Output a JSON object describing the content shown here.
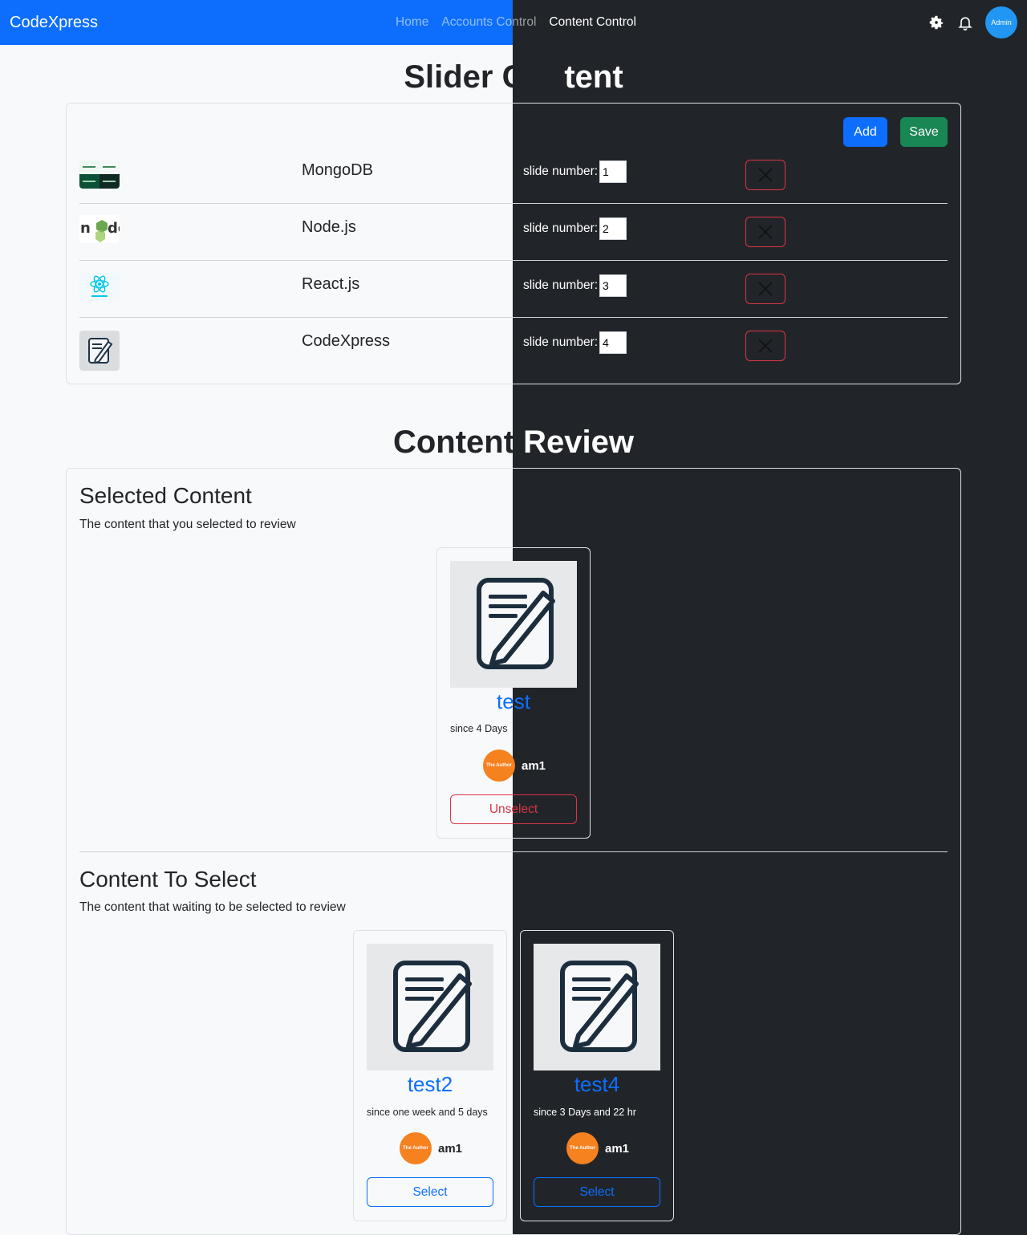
{
  "navbar": {
    "brand": "CodeXpress",
    "links": [
      "Home",
      "Accounts Control",
      "Content Control"
    ],
    "avatar_label": "Admin"
  },
  "slider": {
    "title_left": "Slider Con",
    "title_right": "tent",
    "add_label": "Add",
    "save_label": "Save",
    "slide_label": "slide number:",
    "items": [
      {
        "name": "MongoDB",
        "number": "1"
      },
      {
        "name": "Node.js",
        "number": "2"
      },
      {
        "name": "React.js",
        "number": "3"
      },
      {
        "name": "CodeXpress",
        "number": "4"
      }
    ]
  },
  "review": {
    "title_left": "Content ",
    "title_right": "Review",
    "selected": {
      "heading": "Selected Content",
      "description": "The content that you selected to review",
      "cards": [
        {
          "title": "test",
          "since": "since 4 Days",
          "author": "am1",
          "avatar_text": "The Author",
          "button": "Unselect"
        }
      ]
    },
    "to_select": {
      "heading": "Content To Select",
      "description": "The content that waiting to be selected to review",
      "cards": [
        {
          "title": "test2",
          "since": "since one week and 5 days",
          "author": "am1",
          "avatar_text": "The Author",
          "button": "Select"
        },
        {
          "title": "test4",
          "since": "since 3 Days and 22 hr",
          "author": "am1",
          "avatar_text": "The Author",
          "button": "Select"
        }
      ]
    }
  },
  "colors": {
    "primary": "#0d6efd",
    "success": "#198754",
    "danger": "#dc3545",
    "dark_bg": "#212529",
    "light_bg": "#f8f9fa",
    "author_orange": "#f5811f"
  }
}
